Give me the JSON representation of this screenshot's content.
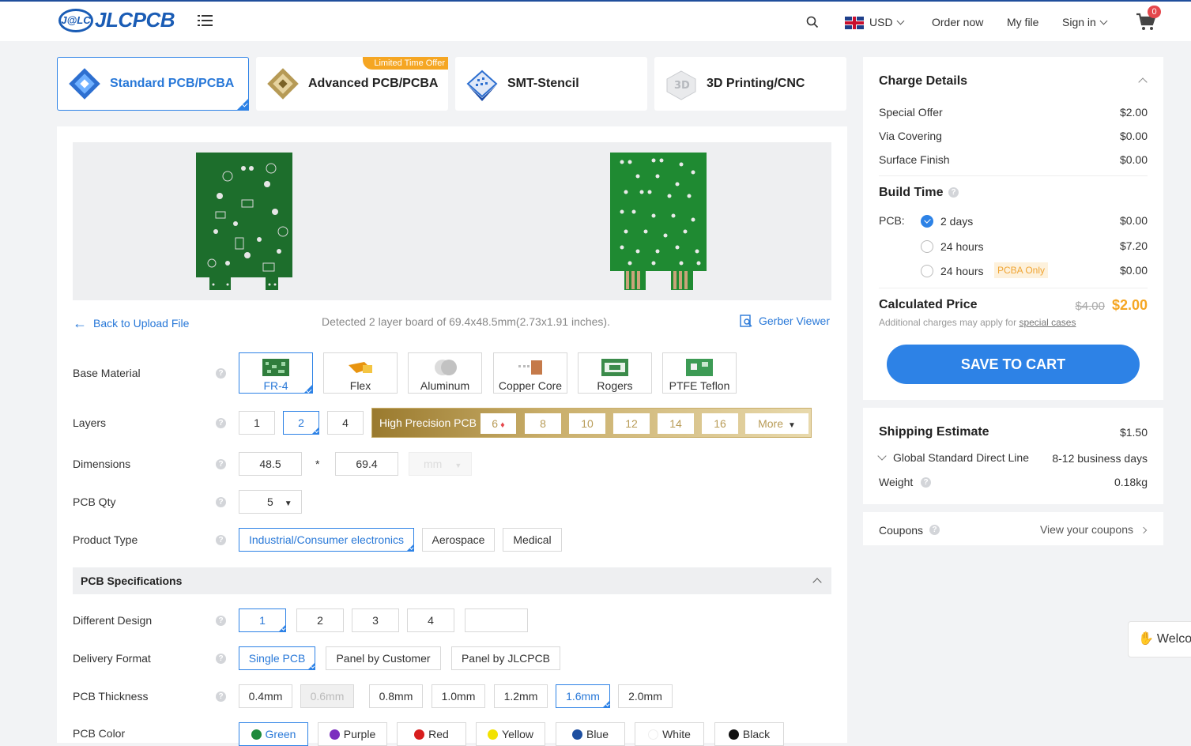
{
  "header": {
    "logo_mark": "J@LC",
    "logo_text": "JLCPCB",
    "currency": "USD",
    "order_now": "Order now",
    "my_file": "My file",
    "sign_in": "Sign in",
    "cart_count": "0"
  },
  "product_tabs": [
    {
      "label": "Standard PCB/PCBA",
      "active": true
    },
    {
      "label": "Advanced PCB/PCBA",
      "badge": "Limited Time Offer"
    },
    {
      "label": "SMT-Stencil"
    },
    {
      "label": "3D Printing/CNC"
    }
  ],
  "upload": {
    "back_label": "Back to Upload File",
    "detected": "Detected 2 layer board of 69.4x48.5mm(2.73x1.91 inches).",
    "gerber_label": "Gerber Viewer"
  },
  "form": {
    "base_material": {
      "label": "Base Material",
      "options": [
        "FR-4",
        "Flex",
        "Aluminum",
        "Copper Core",
        "Rogers",
        "PTFE Teflon"
      ],
      "selected": "FR-4"
    },
    "layers": {
      "label": "Layers",
      "options": [
        "1",
        "2",
        "4"
      ],
      "selected": "2",
      "high_precision_label": "High Precision PCB",
      "hp_options": [
        "6",
        "8",
        "10",
        "12",
        "14",
        "16"
      ],
      "more": "More"
    },
    "dimensions": {
      "label": "Dimensions",
      "width": "48.5",
      "times": "*",
      "height": "69.4",
      "unit": "mm"
    },
    "qty": {
      "label": "PCB Qty",
      "value": "5"
    },
    "product_type": {
      "label": "Product Type",
      "options": [
        "Industrial/Consumer electronics",
        "Aerospace",
        "Medical"
      ],
      "selected": "Industrial/Consumer electronics"
    },
    "spec_header": "PCB Specifications",
    "different_design": {
      "label": "Different Design",
      "options": [
        "1",
        "2",
        "3",
        "4",
        ""
      ],
      "selected": "1"
    },
    "delivery_format": {
      "label": "Delivery Format",
      "options": [
        "Single PCB",
        "Panel by Customer",
        "Panel by JLCPCB"
      ],
      "selected": "Single PCB"
    },
    "thickness": {
      "label": "PCB Thickness",
      "options": [
        "0.4mm",
        "0.6mm",
        "0.8mm",
        "1.0mm",
        "1.2mm",
        "1.6mm",
        "2.0mm"
      ],
      "selected": "1.6mm",
      "disabled": "0.6mm"
    },
    "color": {
      "label": "PCB Color",
      "options": [
        {
          "name": "Green",
          "hex": "#1e8a3c"
        },
        {
          "name": "Purple",
          "hex": "#7b2fbf"
        },
        {
          "name": "Red",
          "hex": "#d81e1e"
        },
        {
          "name": "Yellow",
          "hex": "#f2e200"
        },
        {
          "name": "Blue",
          "hex": "#1e4fa0"
        },
        {
          "name": "White",
          "hex": "#ffffff"
        },
        {
          "name": "Black",
          "hex": "#111111"
        }
      ],
      "selected": "Green"
    }
  },
  "charges": {
    "title": "Charge Details",
    "items": [
      {
        "label": "Special Offer",
        "value": "$2.00"
      },
      {
        "label": "Via Covering",
        "value": "$0.00"
      },
      {
        "label": "Surface Finish",
        "value": "$0.00"
      }
    ],
    "build_time_title": "Build Time",
    "pcb_label": "PCB:",
    "build_options": [
      {
        "label": "2 days",
        "value": "$0.00",
        "checked": true
      },
      {
        "label": "24 hours",
        "value": "$7.20"
      },
      {
        "label": "24 hours",
        "value": "$0.00",
        "tag": "PCBA Only"
      }
    ],
    "calc_title": "Calculated Price",
    "old_price": "$4.00",
    "price": "$2.00",
    "note_prefix": "Additional charges may apply for",
    "note_link": "special cases",
    "save_label": "SAVE TO CART"
  },
  "shipping": {
    "title": "Shipping Estimate",
    "price": "$1.50",
    "method": "Global Standard Direct Line",
    "days": "8-12 business days",
    "weight_label": "Weight",
    "weight": "0.18kg"
  },
  "coupons": {
    "label": "Coupons",
    "link": "View your coupons"
  },
  "chat": {
    "label": "Welcome"
  },
  "colors": {
    "accent": "#2d82e6",
    "price": "#f5a623",
    "brand": "#1a5cb5"
  }
}
